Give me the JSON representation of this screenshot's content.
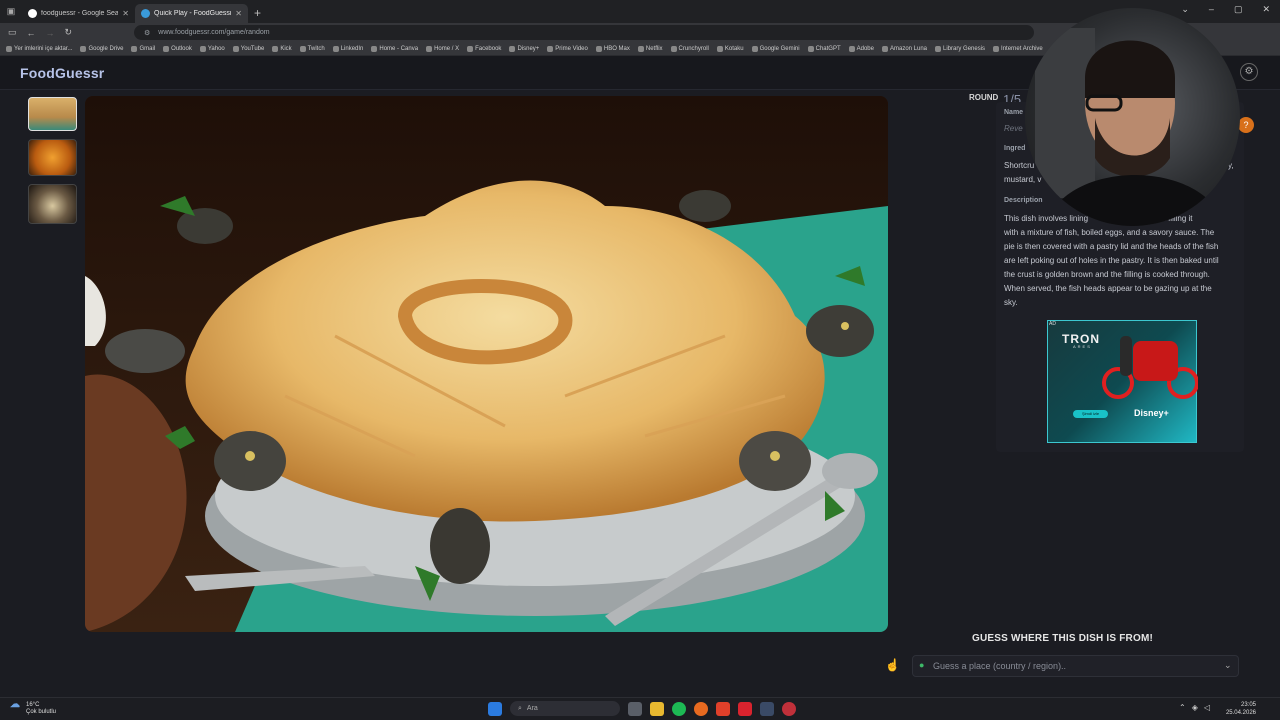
{
  "browser": {
    "tabs": [
      {
        "title": "foodguessr - Google Search",
        "favicon_color": "#ffffff",
        "active": false
      },
      {
        "title": "Quick Play - FoodGuessr | Food",
        "favicon_color": "#3a9ad9",
        "active": true
      }
    ],
    "url": "www.foodguessr.com/game/random",
    "bookmarks": [
      "Yer imlerini içe aktar...",
      "Google Drive",
      "Gmail",
      "Outlook",
      "Yahoo",
      "YouTube",
      "Kick",
      "Twitch",
      "LinkedIn",
      "Home - Canva",
      "Home / X",
      "Facebook",
      "Disney+",
      "Prime Video",
      "HBO Max",
      "Netflix",
      "Crunchyroll",
      "Kotaku",
      "Google Gemini",
      "ChatGPT",
      "Adobe",
      "Amazon Luna",
      "Library Genesis",
      "Internet Archive"
    ]
  },
  "app": {
    "logo": "FoodGuessr",
    "round_label": "ROUND",
    "round_value": "1/5",
    "info": {
      "name_label": "Name",
      "name_value": "Reve",
      "ingredients_label": "Ingred",
      "ingredients_value_1": "Shortcru",
      "ingredients_value_1_end": "y,",
      "ingredients_value_2": "mustard, v",
      "description_label": "Description",
      "description_lines": [
        "This dish involves lining                          , then filling it",
        "with a mixture of fish, boiled eggs, and a savory sauce. The",
        "pie is then covered with a pastry lid and the heads of the fish",
        "are left poking out of holes in the pastry. It is then baked until",
        "the crust is golden brown and the filling is cooked through.",
        "When served, the fish heads appear to be gazing up at the",
        "sky."
      ]
    },
    "ad": {
      "tag": "AD",
      "title": "TRON",
      "subtitle": "ARES",
      "button": "Şimdi izle",
      "brand": "Disney+"
    },
    "guess_title": "GUESS WHERE THIS DISH IS FROM!",
    "guess_placeholder": "Guess a place (country / region)..",
    "help_icon": "?"
  },
  "taskbar": {
    "temp": "16°C",
    "weather": "Çok bulutlu",
    "search": "Ara",
    "time": "23:05",
    "date": "25.04.2026"
  }
}
